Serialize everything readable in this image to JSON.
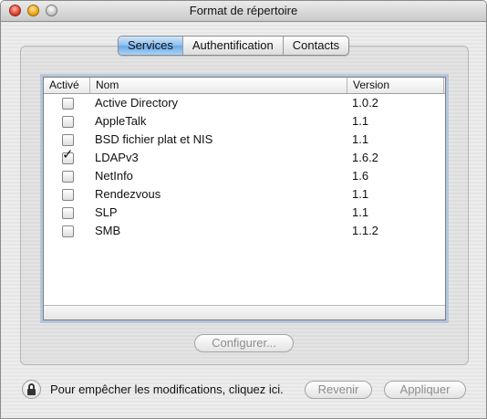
{
  "window": {
    "title": "Format de répertoire"
  },
  "tabs": [
    {
      "label": "Services",
      "active": true
    },
    {
      "label": "Authentification",
      "active": false
    },
    {
      "label": "Contacts",
      "active": false
    }
  ],
  "table": {
    "headers": {
      "active": "Activé",
      "name": "Nom",
      "version": "Version"
    },
    "rows": [
      {
        "checked": false,
        "name": "Active Directory",
        "version": "1.0.2"
      },
      {
        "checked": false,
        "name": "AppleTalk",
        "version": "1.1"
      },
      {
        "checked": false,
        "name": "BSD fichier plat et NIS",
        "version": "1.1"
      },
      {
        "checked": true,
        "name": "LDAPv3",
        "version": "1.6.2"
      },
      {
        "checked": false,
        "name": "NetInfo",
        "version": "1.6"
      },
      {
        "checked": false,
        "name": "Rendezvous",
        "version": "1.1"
      },
      {
        "checked": false,
        "name": "SLP",
        "version": "1.1"
      },
      {
        "checked": false,
        "name": "SMB",
        "version": "1.1.2"
      }
    ]
  },
  "buttons": {
    "configure": "Configurer...",
    "revert": "Revenir",
    "apply": "Appliquer"
  },
  "lock": {
    "text": "Pour empêcher les modifications, cliquez ici.",
    "icon": "lock-icon"
  }
}
